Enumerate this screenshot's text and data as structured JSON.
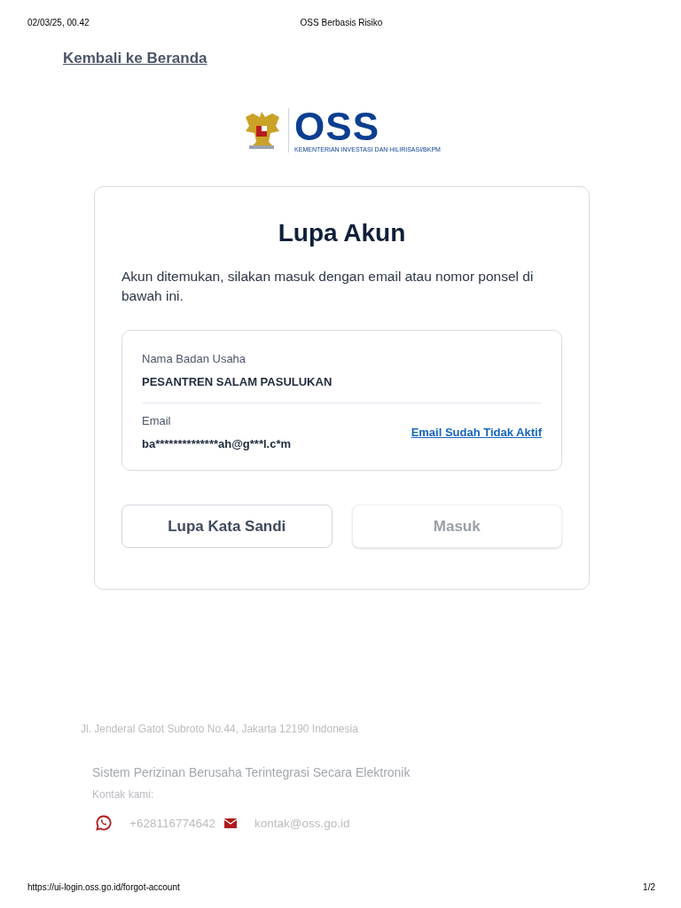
{
  "print_header": {
    "date": "02/03/25, 00.42",
    "title": "OSS Berbasis Risiko"
  },
  "back_link": "Kembali ke Beranda",
  "logo": {
    "wordmark": "OSS",
    "tagline": "KEMENTERIAN INVESTASI DAN HILIRISASI/BKPM"
  },
  "card": {
    "title": "Lupa Akun",
    "message": "Akun ditemukan, silakan masuk dengan email atau nomor ponsel di bawah ini.",
    "account": {
      "name_label": "Nama Badan Usaha",
      "name_value": "PESANTREN SALAM PASULUKAN",
      "email_label": "Email",
      "email_value": "ba**************ah@g***l.c*m",
      "email_link": "Email Sudah Tidak Aktif"
    },
    "buttons": [
      {
        "label": "Lupa Kata Sandi",
        "disabled": false
      },
      {
        "label": "Masuk",
        "disabled": true
      }
    ]
  },
  "footer": {
    "address": "Jl. Jenderal Gatot Subroto No.44, Jakarta 12190 Indonesia",
    "system": "Sistem Perizinan Berusaha Terintegrasi Secara Elektronik",
    "contact_label": "Kontak kami:",
    "phone": "+628116774642",
    "email": "kontak@oss.go.id"
  },
  "print_footer": {
    "url": "https://ui-login.oss.go.id/forgot-account",
    "page": "1/2"
  }
}
